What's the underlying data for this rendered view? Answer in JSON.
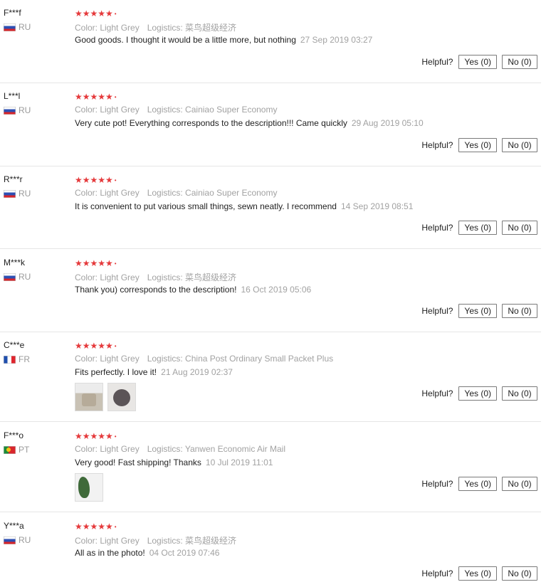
{
  "helpful_label": "Helpful?",
  "reviews": [
    {
      "user": "F***f",
      "country": "RU",
      "flag": "ru",
      "stars": "★★★★★",
      "color": "Color: Light Grey",
      "logistics": "Logistics: 菜鸟超级经济",
      "text": "Good goods. I thought it would be a little more, but nothing",
      "date": "27 Sep 2019 03:27",
      "yes": "Yes (0)",
      "no": "No (0)"
    },
    {
      "user": "L***l",
      "country": "RU",
      "flag": "ru",
      "stars": "★★★★★",
      "color": "Color: Light Grey",
      "logistics": "Logistics: Cainiao Super Economy",
      "text": "Very cute pot! Everything corresponds to the description!!! Came quickly",
      "date": "29 Aug 2019 05:10",
      "yes": "Yes (0)",
      "no": "No (0)"
    },
    {
      "user": "R***r",
      "country": "RU",
      "flag": "ru",
      "stars": "★★★★★",
      "color": "Color: Light Grey",
      "logistics": "Logistics: Cainiao Super Economy",
      "text": "It is convenient to put various small things, sewn neatly. I recommend",
      "date": "14 Sep 2019 08:51",
      "yes": "Yes (0)",
      "no": "No (0)"
    },
    {
      "user": "M***k",
      "country": "RU",
      "flag": "ru",
      "stars": "★★★★★",
      "color": "Color: Light Grey",
      "logistics": "Logistics: 菜鸟超级经济",
      "text": "Thank you) corresponds to the description!",
      "date": "16 Oct 2019 05:06",
      "yes": "Yes (0)",
      "no": "No (0)"
    },
    {
      "user": "C***e",
      "country": "FR",
      "flag": "fr",
      "stars": "★★★★★",
      "color": "Color: Light Grey",
      "logistics": "Logistics: China Post Ordinary Small Packet Plus",
      "text": "Fits perfectly. I love it!",
      "date": "21 Aug 2019 02:37",
      "yes": "Yes (0)",
      "no": "No (0)"
    },
    {
      "user": "F***o",
      "country": "PT",
      "flag": "pt",
      "stars": "★★★★★",
      "color": "Color: Light Grey",
      "logistics": "Logistics: Yanwen Economic Air Mail",
      "text": "Very good! Fast shipping! Thanks",
      "date": "10 Jul 2019 11:01",
      "yes": "Yes (0)",
      "no": "No (0)"
    },
    {
      "user": "Y***a",
      "country": "RU",
      "flag": "ru",
      "stars": "★★★★★",
      "color": "Color: Light Grey",
      "logistics": "Logistics: 菜鸟超级经济",
      "text": "All as in the photo!",
      "date": "04 Oct 2019 07:46",
      "yes": "Yes (0)",
      "no": "No (0)"
    }
  ]
}
